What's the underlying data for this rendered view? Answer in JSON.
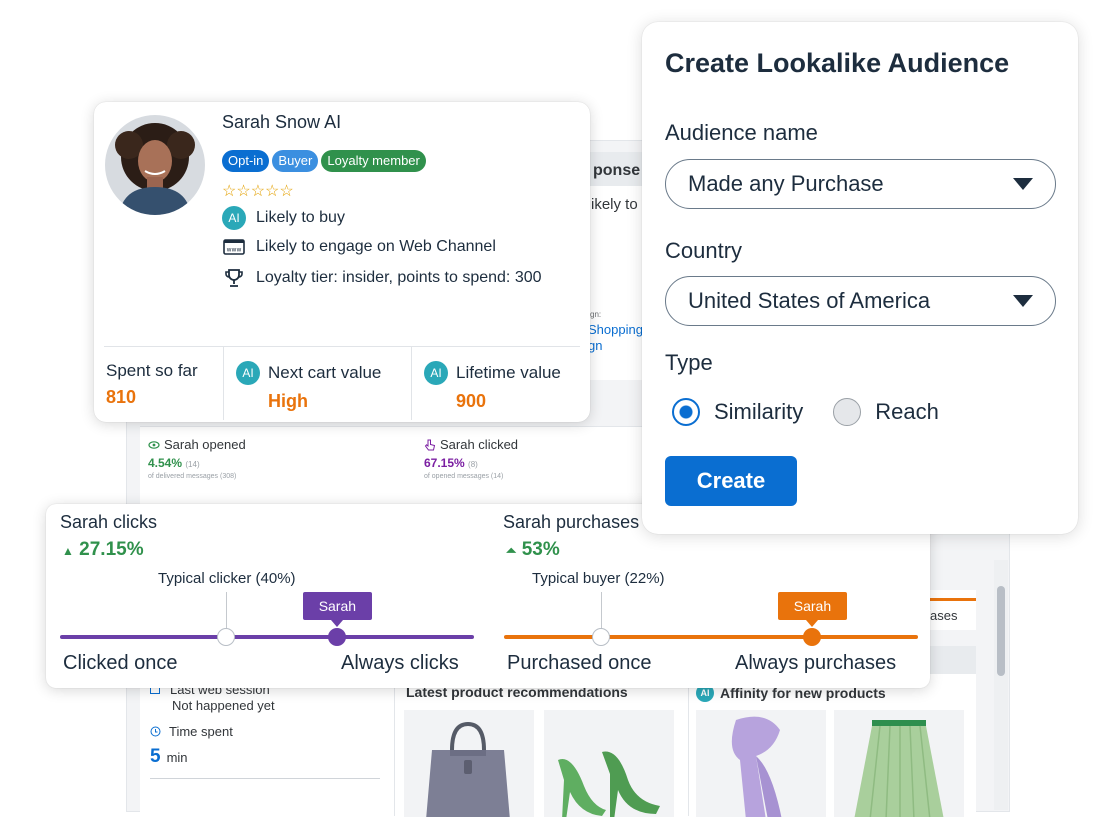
{
  "background": {
    "response_panel": {
      "heading": "ponse",
      "subtext": "ikely to",
      "tiny_label": "gn:",
      "link_1": "Shopping",
      "link_2": "gn"
    },
    "stats": [
      {
        "label": "Sarah opened",
        "icon": "eye-icon",
        "percent": "4.54%",
        "count": "(14)",
        "note": "of delivered messages (308)",
        "color": "#30914c"
      },
      {
        "label": "Sarah clicked",
        "icon": "pointer-icon",
        "percent": "67.15%",
        "count": "(8)",
        "note": "of opened messages (14)",
        "color": "#7b1fa2"
      }
    ],
    "right_strip_text": "ases",
    "lower": {
      "last_web_session_label": "Last web session",
      "last_web_session_value": "Not happened yet",
      "time_spent_label": "Time spent",
      "time_spent_value": "5",
      "time_spent_unit": "min",
      "recommendations_title": "Latest product recommendations",
      "affinity_ai": "AI",
      "affinity_title": "Affinity for new products"
    }
  },
  "profile": {
    "name": "Sarah Snow AI",
    "tags": [
      {
        "label": "Opt-in",
        "color": "#0a6ed1"
      },
      {
        "label": "Buyer",
        "color": "#3b8fe0"
      },
      {
        "label": "Loyalty member",
        "color": "#30914c"
      }
    ],
    "rating_display": "☆☆☆☆☆",
    "features": [
      {
        "icon": "ai-badge-icon",
        "badge": "AI",
        "text": "Likely to buy"
      },
      {
        "icon": "web-channel-icon",
        "badge": "",
        "text": "Likely to engage on Web Channel"
      },
      {
        "icon": "trophy-icon",
        "badge": "",
        "text": "Loyalty tier: insider, points to spend: 300"
      }
    ],
    "metrics": [
      {
        "label": "Spent so far",
        "value": "810",
        "ai": ""
      },
      {
        "label": "Next cart value",
        "value": "High",
        "ai": "AI"
      },
      {
        "label": "Lifetime value",
        "value": "900",
        "ai": "AI"
      }
    ]
  },
  "behavior": {
    "clicks": {
      "title": "Sarah clicks",
      "percent": "27.15%",
      "typical_label": "Typical clicker (40%)",
      "marker_label": "Sarah",
      "min_label": "Clicked once",
      "max_label": "Always clicks",
      "color": "#6b3fa8",
      "typical_position": 0.4,
      "sarah_position": 0.67
    },
    "purchases": {
      "title": "Sarah purchases",
      "percent": "53%",
      "typical_label": "Typical buyer (22%)",
      "marker_label": "Sarah",
      "min_label": "Purchased once",
      "max_label": "Always purchases",
      "color": "#e9730c",
      "typical_position": 0.235,
      "sarah_position": 0.745
    }
  },
  "lookalike": {
    "title": "Create Lookalike Audience",
    "audience_name_label": "Audience name",
    "audience_name_value": "Made any Purchase",
    "country_label": "Country",
    "country_value": "United States of America",
    "type_label": "Type",
    "type_options": [
      "Similarity",
      "Reach"
    ],
    "type_selected": "Similarity",
    "create_button": "Create",
    "accent": "#0a6ed1"
  }
}
